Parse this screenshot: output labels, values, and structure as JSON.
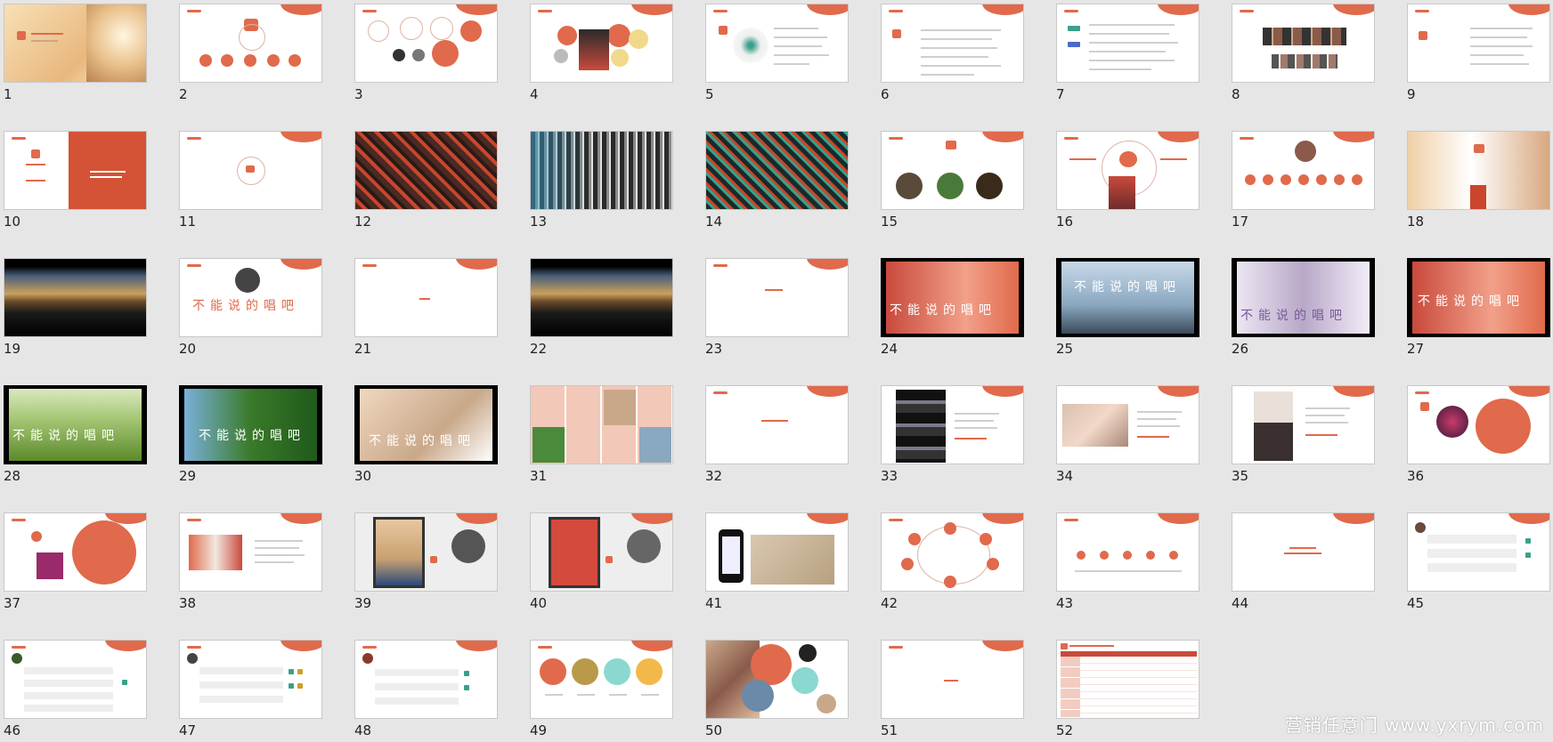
{
  "slides": [
    {
      "num": "1"
    },
    {
      "num": "2"
    },
    {
      "num": "3"
    },
    {
      "num": "4"
    },
    {
      "num": "5"
    },
    {
      "num": "6"
    },
    {
      "num": "7"
    },
    {
      "num": "8"
    },
    {
      "num": "9"
    },
    {
      "num": "10"
    },
    {
      "num": "11"
    },
    {
      "num": "12"
    },
    {
      "num": "13"
    },
    {
      "num": "14"
    },
    {
      "num": "15"
    },
    {
      "num": "16"
    },
    {
      "num": "17"
    },
    {
      "num": "18"
    },
    {
      "num": "19"
    },
    {
      "num": "20"
    },
    {
      "num": "21"
    },
    {
      "num": "22"
    },
    {
      "num": "23"
    },
    {
      "num": "24"
    },
    {
      "num": "25"
    },
    {
      "num": "26"
    },
    {
      "num": "27"
    },
    {
      "num": "28"
    },
    {
      "num": "29"
    },
    {
      "num": "30"
    },
    {
      "num": "31"
    },
    {
      "num": "32"
    },
    {
      "num": "33"
    },
    {
      "num": "34"
    },
    {
      "num": "35"
    },
    {
      "num": "36"
    },
    {
      "num": "37"
    },
    {
      "num": "38"
    },
    {
      "num": "39"
    },
    {
      "num": "40"
    },
    {
      "num": "41"
    },
    {
      "num": "42"
    },
    {
      "num": "43"
    },
    {
      "num": "44"
    },
    {
      "num": "45"
    },
    {
      "num": "46"
    },
    {
      "num": "47"
    },
    {
      "num": "48"
    },
    {
      "num": "49"
    },
    {
      "num": "50"
    },
    {
      "num": "51"
    },
    {
      "num": "52"
    }
  ],
  "calligraphy": "不能说的唱吧",
  "watermark": "营销任意门 www.yxrym.com",
  "colors": {
    "accent": "#e06a4b",
    "background": "#e6e6e6"
  }
}
